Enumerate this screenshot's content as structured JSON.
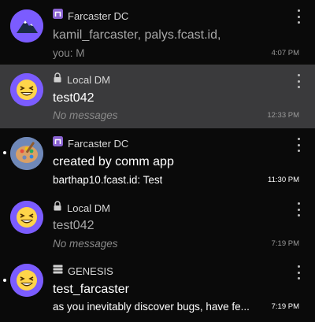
{
  "colors": {
    "background": "#0a0a0a",
    "selected_row": "#3a3a3c",
    "avatar_purple": "#7b5cff",
    "muted_text": "#a8a8a8"
  },
  "threads": [
    {
      "badge_icon": "farcaster-icon",
      "badge": "Farcaster DC",
      "title": "kamil_farcaster, palys.fcast.id,",
      "subtitle": "you: M",
      "time": "4:07 PM",
      "unread": false,
      "selected": false,
      "avatar": "mountain-avatar"
    },
    {
      "badge_icon": "lock-icon",
      "badge": "Local DM",
      "title": "test042",
      "subtitle": "No messages",
      "time": "12:33 PM",
      "unread": false,
      "selected": true,
      "avatar": "grinning-emoji-avatar"
    },
    {
      "badge_icon": "farcaster-icon",
      "badge": "Farcaster DC",
      "title": "created by comm app",
      "subtitle": "barthap10.fcast.id: Test",
      "time": "11:30 PM",
      "unread": true,
      "selected": false,
      "avatar": "palette-emoji-avatar"
    },
    {
      "badge_icon": "lock-icon",
      "badge": "Local DM",
      "title": "test042",
      "subtitle": "No messages",
      "time": "7:19 PM",
      "unread": false,
      "selected": false,
      "avatar": "grinning-emoji-avatar"
    },
    {
      "badge_icon": "server-icon",
      "badge": "GENESIS",
      "title": "test_farcaster",
      "subtitle": "as you inevitably discover bugs, have fe...",
      "time": "7:19 PM",
      "unread": true,
      "selected": false,
      "avatar": "grinning-emoji-avatar"
    }
  ]
}
